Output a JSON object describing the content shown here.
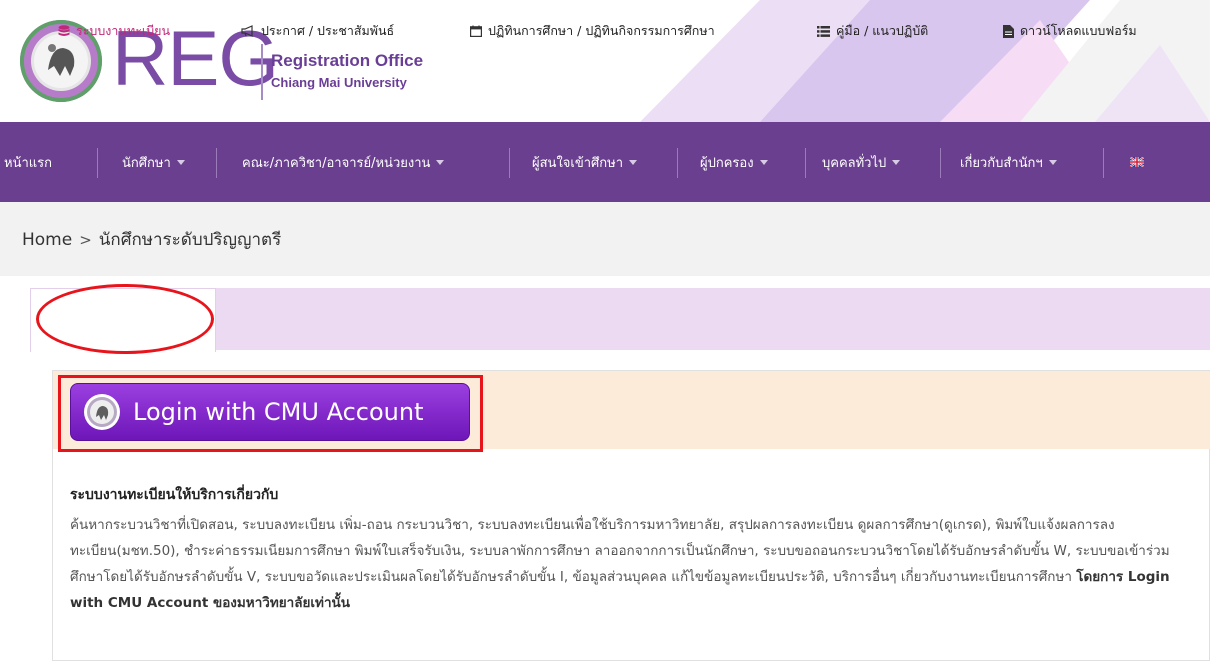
{
  "header": {
    "brand": "REG",
    "office_title": "Registration Office",
    "university": "Chiang Mai University"
  },
  "nav": {
    "items": [
      {
        "label": "หน้าแรก",
        "dropdown": false
      },
      {
        "label": "นักศึกษา",
        "dropdown": true
      },
      {
        "label": "คณะ/ภาควิชา/อาจารย์/หน่วยงาน",
        "dropdown": true
      },
      {
        "label": "ผู้สนใจเข้าศึกษา",
        "dropdown": true
      },
      {
        "label": "ผู้ปกครอง",
        "dropdown": true
      },
      {
        "label": "บุคคลทั่วไป",
        "dropdown": true
      },
      {
        "label": "เกี่ยวกับสำนักฯ",
        "dropdown": true
      }
    ],
    "language_icon": "uk-flag-icon"
  },
  "breadcrumb": {
    "home": "Home",
    "separator": ">",
    "current": "นักศึกษาระดับปริญญาตรี"
  },
  "tabs": [
    {
      "label": "ระบบงานทะเบียน",
      "icon": "database-icon",
      "active": true
    },
    {
      "label": "ประกาศ / ประชาสัมพันธ์",
      "icon": "bullhorn-icon",
      "active": false
    },
    {
      "label": "ปฏิทินการศึกษา / ปฏิทินกิจกรรมการศึกษา",
      "icon": "calendar-icon",
      "active": false
    },
    {
      "label": "คู่มือ / แนวปฏิบัติ",
      "icon": "list-icon",
      "active": false
    },
    {
      "label": "ดาวน์โหลดแบบฟอร์ม",
      "icon": "file-icon",
      "active": false
    }
  ],
  "login": {
    "label": "Login with CMU Account"
  },
  "content": {
    "title": "ระบบงานทะเบียนให้บริการเกี่ยวกับ",
    "description": "ค้นหากระบวนวิชาที่เปิดสอน, ระบบลงทะเบียน เพิ่ม-ถอน กระบวนวิชา, ระบบลงทะเบียนเพื่อใช้บริการมหาวิทยาลัย, สรุปผลการลงทะเบียน ดูผลการศึกษา(ดูเกรด), พิมพ์ใบแจ้งผลการลงทะเบียน(มชท.50), ชำระค่าธรรมเนียมการศึกษา พิมพ์ใบเสร็จรับเงิน, ระบบลาพักการศึกษา ลาออกจากการเป็นนักศึกษา, ระบบขอถอนกระบวนวิชาโดยได้รับอักษรลำดับขั้น W, ระบบขอเข้าร่วมศึกษาโดยได้รับอักษรลำดับขั้น V, ระบบขอวัดและประเมินผลโดยได้รับอักษรลำดับขั้น I, ข้อมูลส่วนบุคคล แก้ไขข้อมูลทะเบียนประวัติ, บริการอื่นๆ เกี่ยวกับงานทะเบียนการศึกษา",
    "emphasis": "โดยการ Login with CMU Account ของมหาวิทยาลัยเท่านั้น"
  },
  "colors": {
    "nav_bg": "#6b3f8f",
    "tab_bar_bg": "#ecdaf3",
    "login_button": "#8a2fd6",
    "annotation_red": "#e8141c",
    "panel_top_bg": "#fcebd9"
  }
}
